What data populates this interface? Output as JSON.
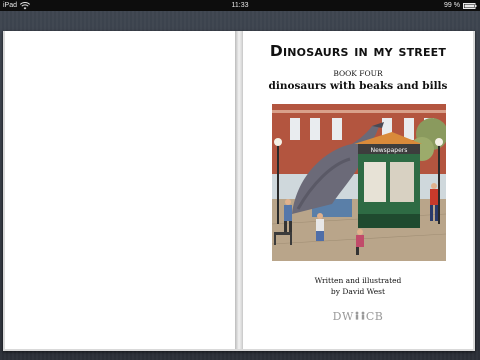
{
  "status_bar": {
    "device": "iPad",
    "time": "11:33",
    "battery": "99 %",
    "icons": [
      "wifi-icon",
      "battery-icon"
    ]
  },
  "book": {
    "title": "Dinosaurs in my street",
    "book_number": "BOOK FOUR",
    "subtitle": "dinosaurs with beaks and bills",
    "illustration": {
      "shop_sign": "Newspapers"
    },
    "credit_line1": "Written and illustrated",
    "credit_line2": "by David West",
    "publisher_left": "DW",
    "publisher_right": "CB"
  },
  "colors": {
    "desk": "#3a3f48",
    "page": "#ffffff",
    "status_bar": "#0d0d0d"
  }
}
